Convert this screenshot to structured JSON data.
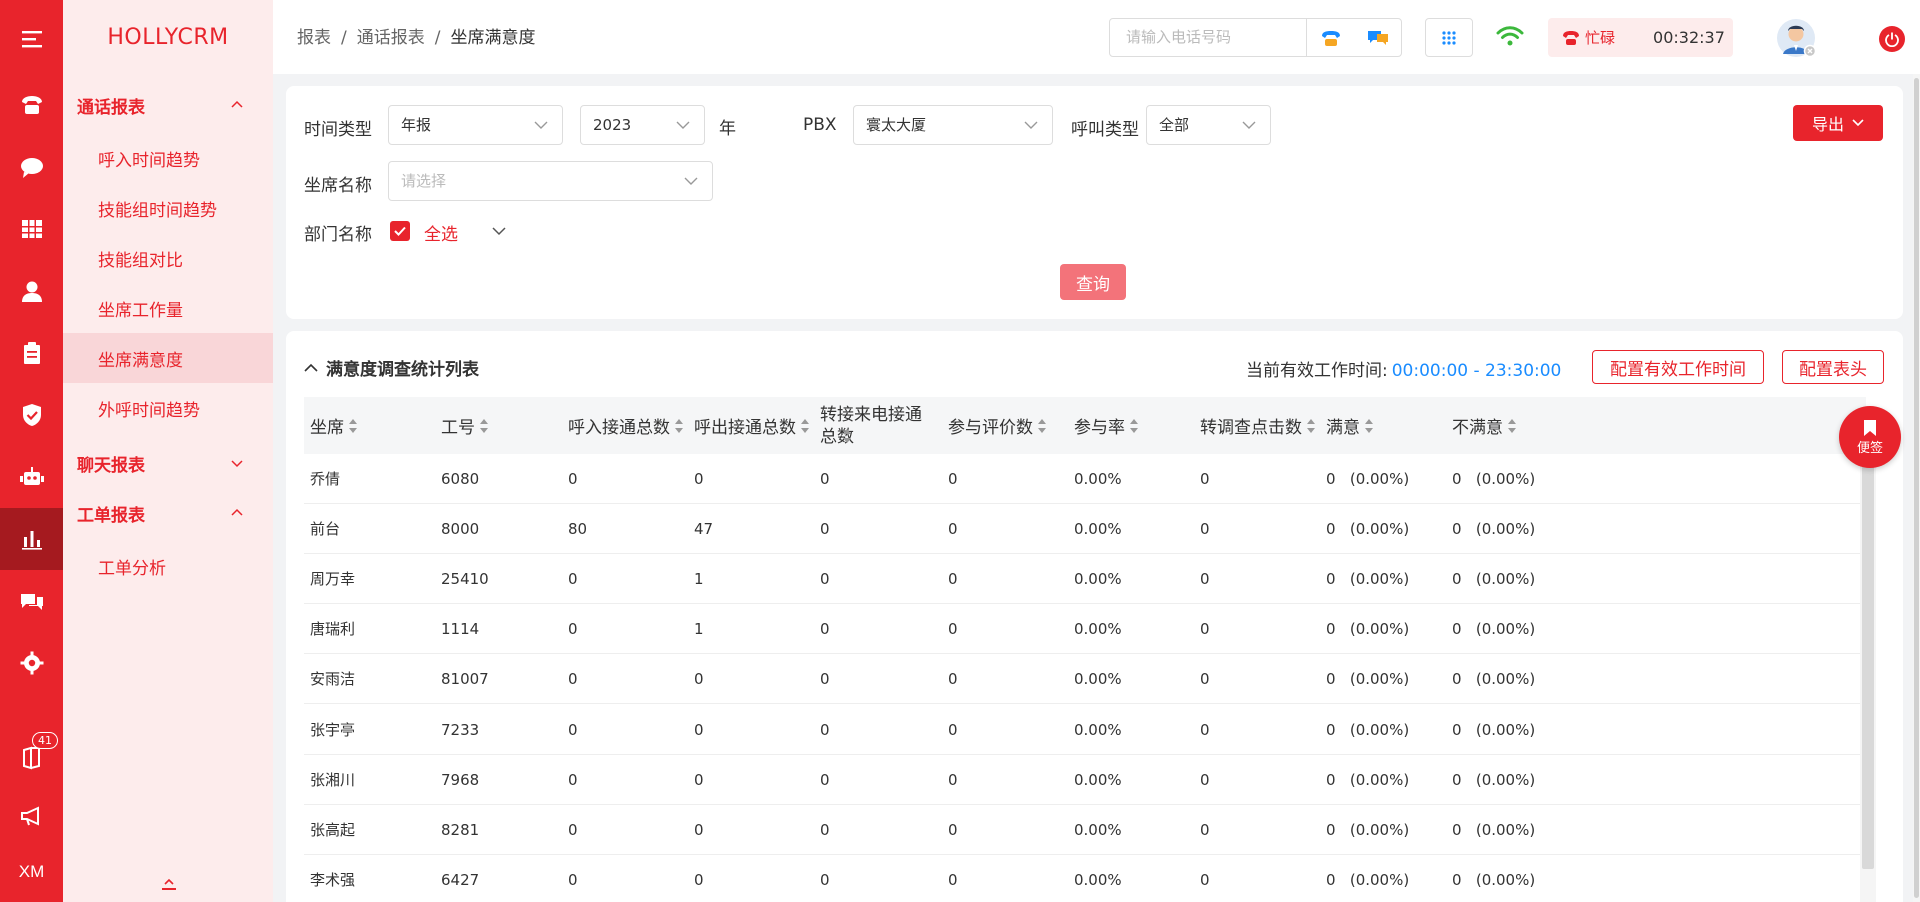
{
  "app": {
    "brand": "HOLLYCRM"
  },
  "rail": {
    "badge_count": "41",
    "xm_label": "XM"
  },
  "menu": {
    "groups": [
      {
        "label": "通话报表"
      },
      {
        "label": "聊天报表"
      },
      {
        "label": "工单报表"
      }
    ],
    "items": [
      {
        "label": "呼入时间趋势"
      },
      {
        "label": "技能组时间趋势"
      },
      {
        "label": "技能组对比"
      },
      {
        "label": "坐席工作量"
      },
      {
        "label": "坐席满意度"
      },
      {
        "label": "外呼时间趋势"
      },
      {
        "label": "工单分析"
      }
    ]
  },
  "header": {
    "breadcrumb": [
      "报表",
      "通话报表",
      "坐席满意度"
    ],
    "breadcrumb_sep": "/",
    "phone_placeholder": "请输入电话号码",
    "status_label": "忙碌",
    "timer": "00:32:37"
  },
  "filter": {
    "time_type_label": "时间类型",
    "time_type_value": "年报",
    "year_value": "2023",
    "year_unit": "年",
    "pbx_label": "PBX",
    "pbx_value": "寰太大厦",
    "call_type_label": "呼叫类型",
    "call_type_value": "全部",
    "agent_name_label": "坐席名称",
    "agent_name_placeholder": "请选择",
    "dept_label": "部门名称",
    "dept_select_all": "全选",
    "export_label": "导出",
    "query_label": "查询"
  },
  "table": {
    "title": "满意度调查统计列表",
    "worktime_label": "当前有效工作时间:",
    "worktime_value": "00:00:00 - 23:30:00",
    "config_worktime_label": "配置有效工作时间",
    "config_header_label": "配置表头",
    "columns": [
      "坐席",
      "工号",
      "呼入接通总数",
      "呼出接通总数",
      "转接来电接通总数",
      "参与评价数",
      "参与率",
      "转调查点击数",
      "满意",
      "不满意"
    ],
    "rows": [
      [
        "乔倩",
        "6080",
        "0",
        "0",
        "0",
        "0",
        "0.00%",
        "0",
        "0   (0.00%)",
        "0   (0.00%)"
      ],
      [
        "前台",
        "8000",
        "80",
        "47",
        "0",
        "0",
        "0.00%",
        "0",
        "0   (0.00%)",
        "0   (0.00%)"
      ],
      [
        "周万幸",
        "25410",
        "0",
        "1",
        "0",
        "0",
        "0.00%",
        "0",
        "0   (0.00%)",
        "0   (0.00%)"
      ],
      [
        "唐瑞利",
        "1114",
        "0",
        "1",
        "0",
        "0",
        "0.00%",
        "0",
        "0   (0.00%)",
        "0   (0.00%)"
      ],
      [
        "安雨洁",
        "81007",
        "0",
        "0",
        "0",
        "0",
        "0.00%",
        "0",
        "0   (0.00%)",
        "0   (0.00%)"
      ],
      [
        "张宇亭",
        "7233",
        "0",
        "0",
        "0",
        "0",
        "0.00%",
        "0",
        "0   (0.00%)",
        "0   (0.00%)"
      ],
      [
        "张湘川",
        "7968",
        "0",
        "0",
        "0",
        "0",
        "0.00%",
        "0",
        "0   (0.00%)",
        "0   (0.00%)"
      ],
      [
        "张高起",
        "8281",
        "0",
        "0",
        "0",
        "0",
        "0.00%",
        "0",
        "0   (0.00%)",
        "0   (0.00%)"
      ],
      [
        "李术强",
        "6427",
        "0",
        "0",
        "0",
        "0",
        "0.00%",
        "0",
        "0   (0.00%)",
        "0   (0.00%)"
      ]
    ]
  },
  "note_button": {
    "label": "便签"
  },
  "colors": {
    "accent": "#e8242c",
    "accent_dark": "#a51a1f",
    "menu_bg": "#fdecec",
    "link_blue": "#1a8cff"
  }
}
